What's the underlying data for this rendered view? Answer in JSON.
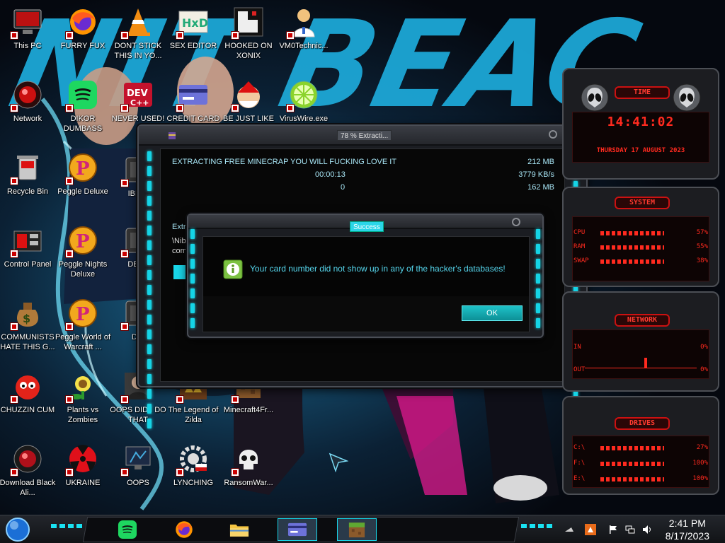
{
  "desktop": {
    "wallpaper_text": "NIT BEAC",
    "icons": [
      {
        "label": "This PC",
        "icon": "computer-icon"
      },
      {
        "label": "FURRY FUX",
        "icon": "firefox-icon"
      },
      {
        "label": "DONT STICK THIS IN YO...",
        "icon": "vlc-cone-icon"
      },
      {
        "label": "SEX EDITOR",
        "icon": "hex-editor-icon"
      },
      {
        "label": "HOOKED ON XONIX",
        "icon": "xonix-game-icon"
      },
      {
        "label": "VM0Technic...",
        "icon": "doctor-icon"
      },
      {
        "label": "Network",
        "icon": "network-icon"
      },
      {
        "label": "DIKOR DUMBASS",
        "icon": "spotify-icon"
      },
      {
        "label": "NEVER USED!",
        "icon": "dev-cpp-icon"
      },
      {
        "label": "CREDIT CARD",
        "icon": "credit-card-icon"
      },
      {
        "label": "BE JUST LIKE",
        "icon": "santa-icon"
      },
      {
        "label": "VirusWire.exe",
        "icon": "lime-icon"
      },
      {
        "label": "Recycle Bin",
        "icon": "recycle-bin-icon"
      },
      {
        "label": "Peggle Deluxe",
        "icon": "peggle-icon"
      },
      {
        "label": "IBRAI",
        "icon": "app-icon"
      },
      {
        "label": "Control Panel",
        "icon": "control-panel-icon"
      },
      {
        "label": "Peggle Nights Deluxe",
        "icon": "peggle-icon"
      },
      {
        "label": "DEEZ",
        "icon": "app-icon"
      },
      {
        "label": "COMMUNISTS HATE THIS G...",
        "icon": "money-bag-icon"
      },
      {
        "label": "Peggle World of Warcraft ...",
        "icon": "peggle-icon"
      },
      {
        "label": "DIE",
        "icon": "app-icon"
      },
      {
        "label": "CHUZZIN CUM",
        "icon": "chuzzle-icon"
      },
      {
        "label": "Plants vs Zombies",
        "icon": "plants-icon"
      },
      {
        "label": "OOPS DID I DO THAT",
        "icon": "portrait-icon"
      },
      {
        "label": "The Legend of Zilda",
        "icon": "zelda-icon"
      },
      {
        "label": "Minecraft4Fr...",
        "icon": "minecraft-icon"
      },
      {
        "label": "Download Black Ali...",
        "icon": "alien-orb-icon"
      },
      {
        "label": "UKRAINE",
        "icon": "radiation-icon"
      },
      {
        "label": "OOPS",
        "icon": "monitor-icon"
      },
      {
        "label": "LYNCHING",
        "icon": "gear-flag-icon"
      },
      {
        "label": "RansomWar...",
        "icon": "skull-icon"
      }
    ]
  },
  "extract_window": {
    "title": "78 % Extracti...",
    "file_label": "EXTRACTING FREE MINECRAP YOU WILL FUCKING LOVE IT",
    "size_total": "212 MB",
    "elapsed": "00:00:13",
    "speed": "3779 KB/s",
    "remaining_label": "0",
    "size_done": "162 MB",
    "partial_label1": "Extra",
    "partial_label2": "\\Nib\\",
    "partial_label3": "com",
    "progress_fraction": 0.78
  },
  "success_dialog": {
    "title": "Success",
    "message": "Your card number did not show up in any of the hacker's databases!",
    "ok_label": "OK"
  },
  "gadget": {
    "time_title": "TIME",
    "time_value": "14:41:02",
    "date_value": "THURSDAY 17 AUGUST 2023",
    "system_title": "SYSTEM",
    "system_rows": [
      {
        "label": "CPU",
        "value": "57%"
      },
      {
        "label": "RAM",
        "value": "55%"
      },
      {
        "label": "SWAP",
        "value": "38%"
      }
    ],
    "network_title": "NETWORK",
    "network_rows": [
      {
        "label": "IN",
        "value": "0%"
      },
      {
        "label": "OUT",
        "value": "0%"
      }
    ],
    "drives_title": "DRIVES",
    "drive_rows": [
      {
        "label": "C:\\",
        "value": "27%"
      },
      {
        "label": "F:\\",
        "value": "100%"
      },
      {
        "label": "E:\\",
        "value": "100%"
      }
    ]
  },
  "taskbar": {
    "apps": [
      "spotify-icon",
      "firefox-icon",
      "file-explorer-icon",
      "credit-card-icon",
      "minecraft-icon"
    ],
    "time": "2:41 PM",
    "date": "8/17/2023"
  },
  "colors": {
    "accent_cyan": "#15d4e6",
    "gadget_red": "#ff2a1f"
  }
}
